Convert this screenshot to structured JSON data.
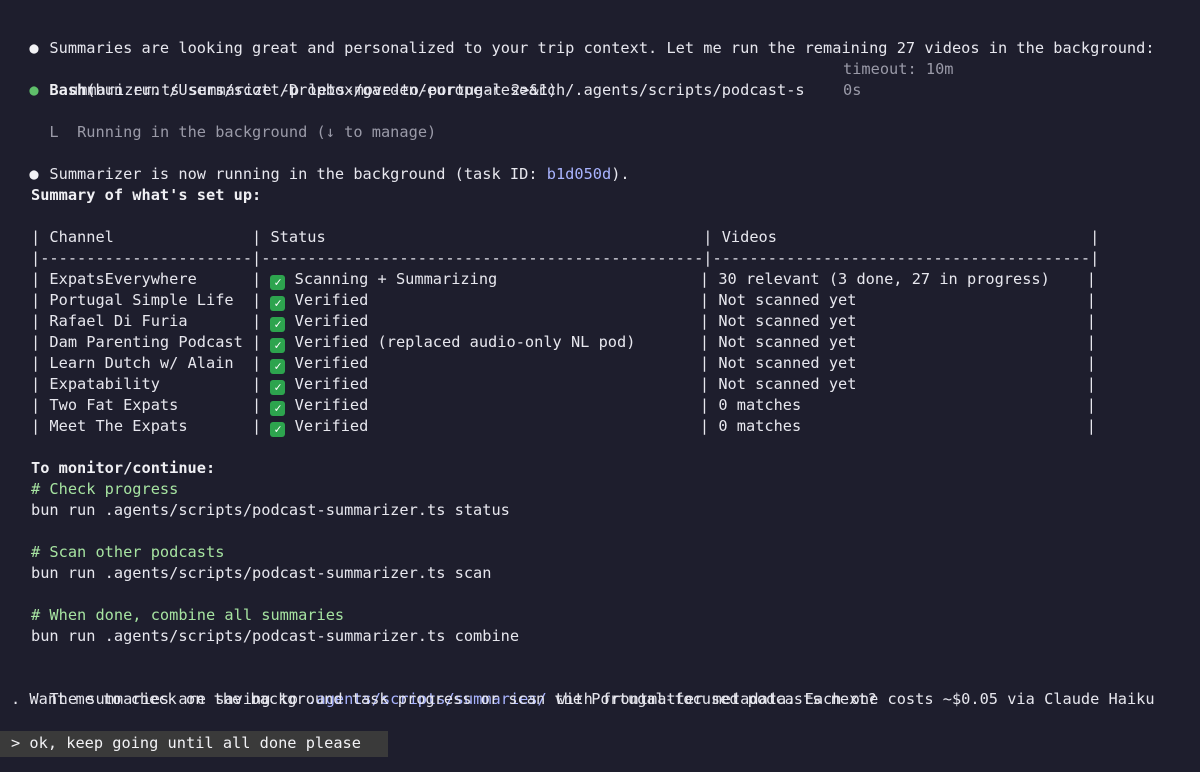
{
  "messages": {
    "intro": "Summaries are looking great and personalized to your trip context. Let me run the remaining 27 videos in the background:",
    "bash_label": "Bash",
    "bash_cmd_1": "(bun run /Users/scott/Dropbox/garden/europe-research/.agents/scripts/podcast-s",
    "bash_cmd_2": "ummarizer.ts summarize -p lets-move-to-portugal 2>&1)",
    "timeout_label": "timeout: 10m",
    "elapsed": "0s",
    "bg_note_glyph": "L",
    "bg_note": "Running in the background (↓ to manage)",
    "running_prefix": "Summarizer is now running in the background (task ID: ",
    "task_id": "b1d050d",
    "running_suffix": ").",
    "summary_heading": "Summary of what's set up:"
  },
  "table": {
    "header_line": "| Channel               | Status                                         | Videos                                  |",
    "divider_line": "|-----------------------|------------------------------------------------|-----------------------------------------|",
    "rows": [
      {
        "channel": "ExpatsEverywhere",
        "status": "Scanning + Summarizing",
        "videos": "30 relevant (3 done, 27 in progress)"
      },
      {
        "channel": "Portugal Simple Life",
        "status": "Verified",
        "videos": "Not scanned yet"
      },
      {
        "channel": "Rafael Di Furia",
        "status": "Verified",
        "videos": "Not scanned yet"
      },
      {
        "channel": "Dam Parenting Podcast",
        "status": "Verified (replaced audio-only NL pod)",
        "videos": "Not scanned yet"
      },
      {
        "channel": "Learn Dutch w/ Alain",
        "status": "Verified",
        "videos": "Not scanned yet"
      },
      {
        "channel": "Expatability",
        "status": "Verified",
        "videos": "Not scanned yet"
      },
      {
        "channel": "Two Fat Expats",
        "status": "Verified",
        "videos": "0 matches"
      },
      {
        "channel": "Meet The Expats",
        "status": "Verified",
        "videos": "0 matches"
      }
    ]
  },
  "monitor": {
    "heading": "To monitor/continue:",
    "c1": "# Check progress",
    "cmd1": "bun run .agents/scripts/podcast-summarizer.ts status",
    "c2": "# Scan other podcasts",
    "cmd2": "bun run .agents/scripts/podcast-summarizer.ts scan",
    "c3": "# When done, combine all summaries",
    "cmd3": "bun run .agents/scripts/podcast-summarizer.ts combine"
  },
  "footer": {
    "p1_prefix": "The summaries are saving to ",
    "p1_path": ".agents/scripts/summaries/",
    "p1_suffix": " with frontmatter metadata. Each one costs ~$0.05 via Claude Haiku",
    "p2": ". Want me to check on the background task progress or scan the Portugal-focused podcasts next?"
  },
  "prompt": {
    "text": "> ok, keep going until all done please"
  },
  "colors": {
    "background": "#1e1e2d",
    "success_dot": "#5fbf6a",
    "accent": "#a9b4ff",
    "comment": "#a6e3a1",
    "check_bg": "#2da44e"
  }
}
